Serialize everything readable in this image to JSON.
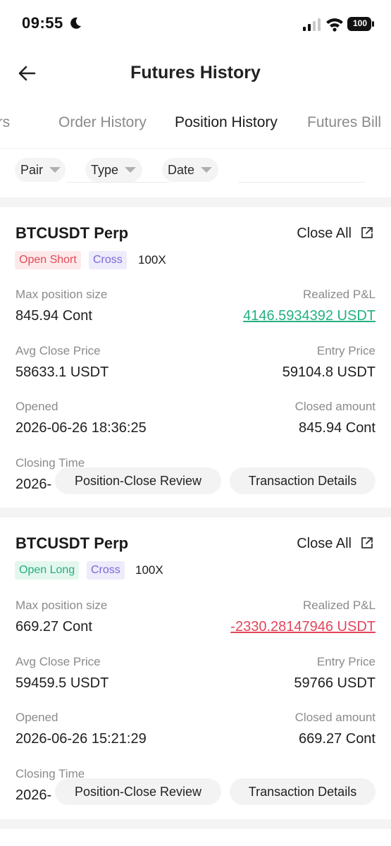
{
  "status_bar": {
    "time": "09:55",
    "battery": "100"
  },
  "header": {
    "title": "Futures History"
  },
  "tabs": [
    {
      "label": "Orders"
    },
    {
      "label": "Order History"
    },
    {
      "label": "Position History"
    },
    {
      "label": "Futures Bill"
    }
  ],
  "filters": {
    "pair": "Pair",
    "type": "Type",
    "date": "Date"
  },
  "labels": {
    "max_position_size": "Max position size",
    "realized_pnl": "Realized P&L",
    "avg_close_price": "Avg Close Price",
    "entry_price": "Entry Price",
    "opened": "Opened",
    "closed_amount": "Closed amount",
    "closing_time": "Closing Time",
    "close_all": "Close All",
    "position_close_review": "Position-Close Review",
    "transaction_details": "Transaction Details"
  },
  "positions": [
    {
      "pair": "BTCUSDT Perp",
      "side": "Open Short",
      "margin_mode": "Cross",
      "leverage": "100X",
      "max_position_size": "845.94 Cont",
      "realized_pnl": "4146.5934392 USDT",
      "avg_close_price": "58633.1 USDT",
      "entry_price": "59104.8 USDT",
      "opened": "2026-06-26 18:36:25",
      "closed_amount": "845.94 Cont",
      "closing_time": "2026-"
    },
    {
      "pair": "BTCUSDT Perp",
      "side": "Open Long",
      "margin_mode": "Cross",
      "leverage": "100X",
      "max_position_size": "669.27 Cont",
      "realized_pnl": "-2330.28147946 USDT",
      "avg_close_price": "59459.5 USDT",
      "entry_price": "59766 USDT",
      "opened": "2026-06-26 15:21:29",
      "closed_amount": "669.27 Cont",
      "closing_time": "2026-"
    }
  ],
  "colors": {
    "profit": "#23b07f",
    "loss": "#e2455a",
    "short_badge": "#e24b57",
    "long_badge": "#22b07d",
    "cross_badge": "#7a67d8"
  }
}
